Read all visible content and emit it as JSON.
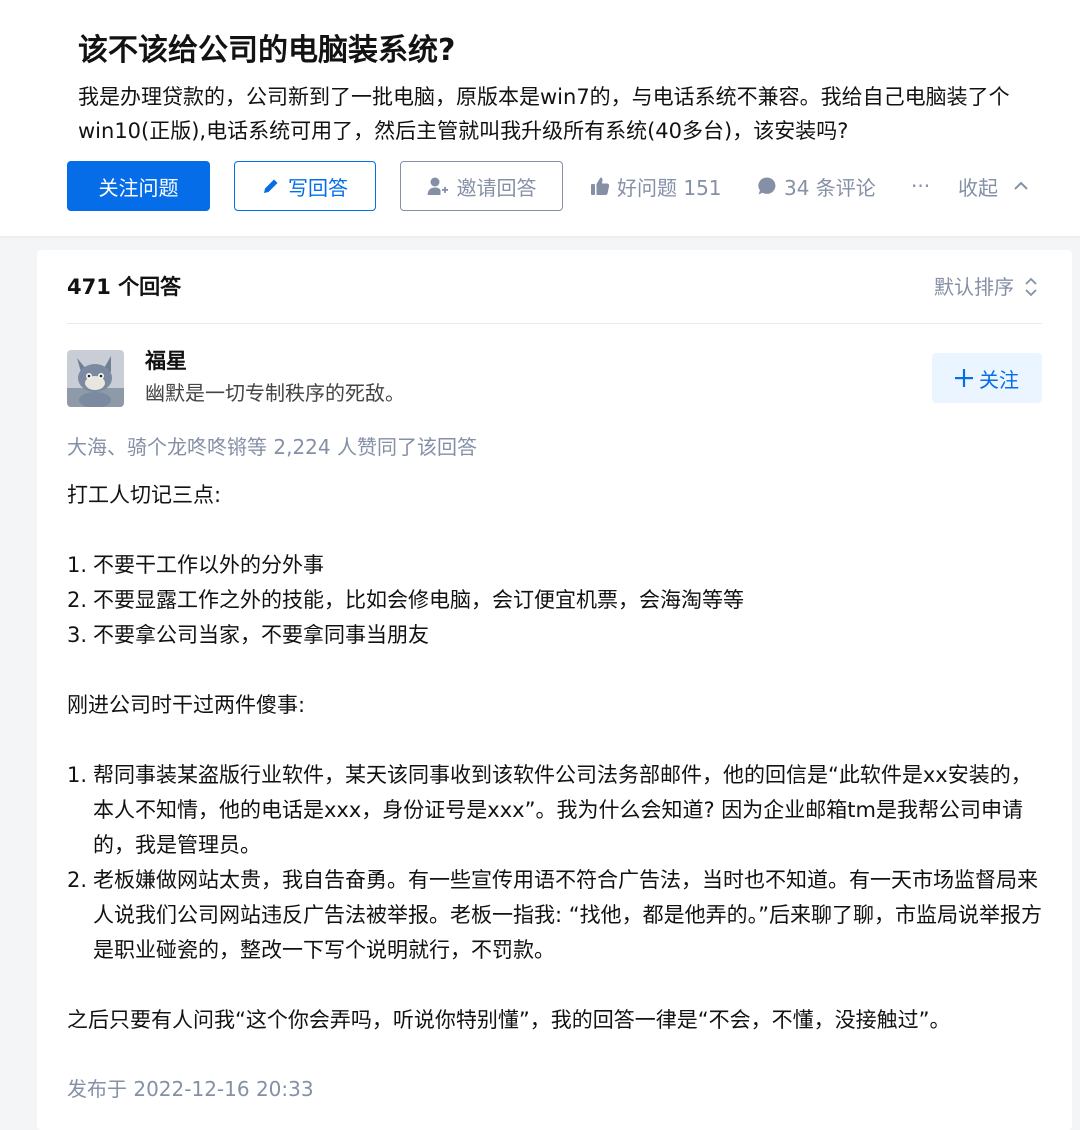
{
  "question": {
    "title": "该不该给公司的电脑装系统?",
    "detail": "我是办理贷款的，公司新到了一批电脑，原版本是win7的，与电话系统不兼容。我给自己电脑装了个win10(正版),电话系统可用了，然后主管就叫我升级所有系统(40多台)，该安装吗?"
  },
  "actions": {
    "follow_label": "关注问题",
    "write_label": "写回答",
    "invite_label": "邀请回答",
    "good_question": "好问题 151",
    "comments": "34 条评论",
    "more": "···",
    "collapse": "收起"
  },
  "answers": {
    "count_label": "471 个回答",
    "sort_label": "默认排序"
  },
  "answer": {
    "author_name": "福星",
    "author_bio": "幽默是一切专制秩序的死敌。",
    "follow_label": "关注",
    "voters": "大海、骑个龙咚咚锵等 2,224 人赞同了该回答",
    "intro1": "打工人切记三点:",
    "points": [
      {
        "num": "1.",
        "text": "不要干工作以外的分外事"
      },
      {
        "num": "2.",
        "text": "不要显露工作之外的技能，比如会修电脑，会订便宜机票，会海淘等等"
      },
      {
        "num": "3.",
        "text": "不要拿公司当家，不要拿同事当朋友"
      }
    ],
    "intro2": "刚进公司时干过两件傻事:",
    "stories": [
      {
        "num": "1.",
        "text": "帮同事装某盗版行业软件，某天该同事收到该软件公司法务部邮件，他的回信是“此软件是xx安装的，本人不知情，他的电话是xxx，身份证号是xxx”。我为什么会知道? 因为企业邮箱tm是我帮公司申请的，我是管理员。"
      },
      {
        "num": "2.",
        "text": "老板嫌做网站太贵，我自告奋勇。有一些宣传用语不符合广告法，当时也不知道。有一天市场监督局来人说我们公司网站违反广告法被举报。老板一指我: “找他，都是他弄的。”后来聊了聊，市监局说举报方是职业碰瓷的，整改一下写个说明就行，不罚款。"
      }
    ],
    "conclusion": "之后只要有人问我“这个你会弄吗，听说你特别懂”，我的回答一律是“不会，不懂，没接触过”。",
    "published": "发布于 2022-12-16 20:33"
  },
  "colors": {
    "primary": "#056de8",
    "muted": "#8590a6",
    "text": "#121212",
    "follow_bg": "#ebf5ff"
  },
  "icons": [
    "pencil-icon",
    "invite-user-icon",
    "thumbs-up-icon",
    "comment-bubble-icon",
    "chevron-up-icon",
    "sort-arrows-icon",
    "plus-icon"
  ]
}
